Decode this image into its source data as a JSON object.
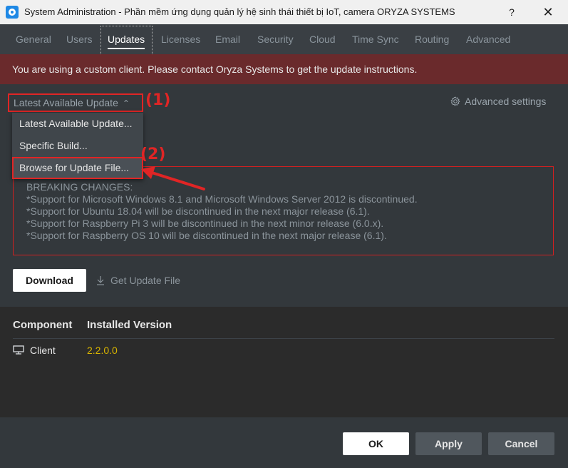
{
  "window": {
    "title": "System Administration - Phần mềm ứng dụng quản lý hệ sinh thái thiết bị IoT, camera ORYZA SYSTEMS",
    "help_label": "?",
    "close_label": "✕"
  },
  "tabs": [
    {
      "label": "General"
    },
    {
      "label": "Users"
    },
    {
      "label": "Updates",
      "active": true
    },
    {
      "label": "Licenses"
    },
    {
      "label": "Email"
    },
    {
      "label": "Security"
    },
    {
      "label": "Cloud"
    },
    {
      "label": "Time Sync"
    },
    {
      "label": "Routing"
    },
    {
      "label": "Advanced"
    }
  ],
  "banner": {
    "text": "You are using a custom client. Please contact Oryza Systems to get the update instructions."
  },
  "update_source": {
    "selected": "Latest Available Update",
    "options": [
      "Latest Available Update...",
      "Specific Build...",
      "Browse for Update File..."
    ]
  },
  "annotations": {
    "label1": "(1)",
    "label2": "(2)"
  },
  "advanced_settings_label": "Advanced settings",
  "release_notes": {
    "text": "BREAKING CHANGES:\n*Support for Microsoft Windows 8.1 and Microsoft Windows Server 2012 is discontinued.\n*Support for Ubuntu 18.04 will be discontinued in the next major release (6.1).\n*Support for Raspberry Pi 3 will be discontinued in the next minor release (6.0.x).\n*Support for Raspberry OS 10 will be discontinued in the next major release (6.1)."
  },
  "actions": {
    "download_label": "Download",
    "get_update_file_label": "Get Update File"
  },
  "components": {
    "headers": [
      "Component",
      "Installed Version"
    ],
    "rows": [
      {
        "name": "Client",
        "version": "2.2.0.0"
      }
    ]
  },
  "footer": {
    "ok_label": "OK",
    "apply_label": "Apply",
    "cancel_label": "Cancel"
  },
  "colors": {
    "accent_red": "#e02525",
    "version_yellow": "#d8b400",
    "banner_bg": "#6a2a2c"
  },
  "icons": {
    "app": "oryza-app-icon",
    "gear": "gear-icon",
    "download": "download-icon",
    "monitor": "monitor-icon",
    "chevron": "chevron-up-icon"
  }
}
